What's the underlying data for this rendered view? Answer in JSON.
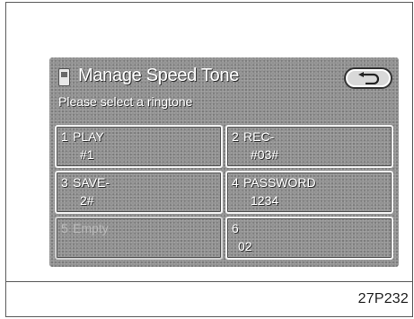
{
  "screen": {
    "title": "Manage Speed Tone",
    "subtitle": "Please select a ringtone",
    "back_icon": "return-arrow-icon",
    "phone_icon": "phone-icon"
  },
  "slots": [
    {
      "number": "1",
      "name": "PLAY",
      "code": "#1",
      "enabled": true
    },
    {
      "number": "2",
      "name": "REC-",
      "code": "#03#",
      "enabled": true
    },
    {
      "number": "3",
      "name": "SAVE-",
      "code": "2#",
      "enabled": true
    },
    {
      "number": "4",
      "name": "PASSWORD",
      "code": "1234",
      "enabled": true
    },
    {
      "number": "5",
      "name": "Empty",
      "code": "",
      "enabled": false
    },
    {
      "number": "6",
      "name": "",
      "code": "02",
      "enabled": true
    }
  ],
  "figure_id": "27P232"
}
